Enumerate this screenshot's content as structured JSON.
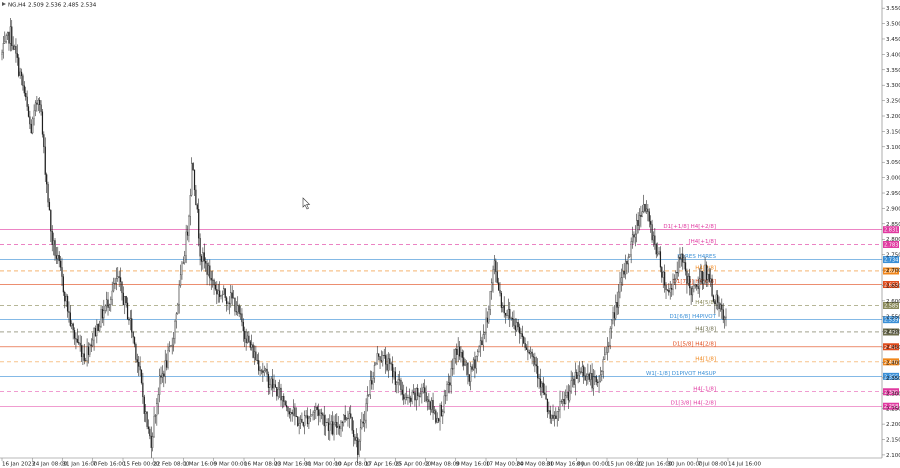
{
  "header": {
    "symbol_label": "NG,H4",
    "ohlc_text": "2.509 2.536 2.485 2.534"
  },
  "colors": {
    "background": "#ffffff",
    "candle": "#1a1a1a",
    "grid": "#e6e6e6",
    "axis": "#777777"
  },
  "chart_data": {
    "type": "candlestick",
    "ylim": [
      2.09,
      3.57
    ],
    "y_ticks": [
      "3.550",
      "3.500",
      "3.450",
      "3.400",
      "3.350",
      "3.300",
      "3.250",
      "3.200",
      "3.150",
      "3.100",
      "3.050",
      "3.000",
      "2.950",
      "2.900",
      "2.850",
      "2.800",
      "2.750",
      "2.700",
      "2.650",
      "2.600",
      "2.550",
      "2.500",
      "2.450",
      "2.400",
      "2.350",
      "2.300",
      "2.250",
      "2.200",
      "2.150",
      "2.100"
    ],
    "x_ticks": [
      "16 Jan 2023",
      "24 Jan 08:00",
      "31 Jan 16:00",
      "7 Feb 16:00",
      "15 Feb 00:00",
      "22 Feb 08:00",
      "1 Mar 16:00",
      "9 Mar 00:00",
      "16 Mar 08:00",
      "23 Mar 16:00",
      "31 Mar 00:00",
      "10 Apr 08:00",
      "17 Apr 16:00",
      "25 Apr 00:00",
      "2 May 08:00",
      "9 May 16:00",
      "17 May 00:00",
      "24 May 08:00",
      "31 May 16:00",
      "8 Jun 00:00",
      "15 Jun 08:00",
      "22 Jun 16:00",
      "30 Jun 00:00",
      "7 Jul 08:00",
      "14 Jul 16:00"
    ],
    "price_path": [
      [
        0,
        3.4
      ],
      [
        0.01,
        3.47
      ],
      [
        0.025,
        3.3
      ],
      [
        0.035,
        3.15
      ],
      [
        0.045,
        3.28
      ],
      [
        0.05,
        3.1
      ],
      [
        0.06,
        2.8
      ],
      [
        0.07,
        2.7
      ],
      [
        0.085,
        2.5
      ],
      [
        0.1,
        2.42
      ],
      [
        0.12,
        2.55
      ],
      [
        0.14,
        2.67
      ],
      [
        0.155,
        2.53
      ],
      [
        0.165,
        2.39
      ],
      [
        0.175,
        2.2
      ],
      [
        0.18,
        2.14
      ],
      [
        0.19,
        2.33
      ],
      [
        0.205,
        2.45
      ],
      [
        0.215,
        2.65
      ],
      [
        0.225,
        2.85
      ],
      [
        0.23,
        3.07
      ],
      [
        0.24,
        2.75
      ],
      [
        0.26,
        2.63
      ],
      [
        0.28,
        2.6
      ],
      [
        0.3,
        2.45
      ],
      [
        0.32,
        2.35
      ],
      [
        0.34,
        2.28
      ],
      [
        0.36,
        2.2
      ],
      [
        0.38,
        2.25
      ],
      [
        0.4,
        2.18
      ],
      [
        0.42,
        2.24
      ],
      [
        0.43,
        2.12
      ],
      [
        0.445,
        2.33
      ],
      [
        0.455,
        2.43
      ],
      [
        0.47,
        2.38
      ],
      [
        0.49,
        2.27
      ],
      [
        0.51,
        2.31
      ],
      [
        0.525,
        2.22
      ],
      [
        0.535,
        2.27
      ],
      [
        0.55,
        2.45
      ],
      [
        0.565,
        2.35
      ],
      [
        0.585,
        2.52
      ],
      [
        0.595,
        2.72
      ],
      [
        0.605,
        2.58
      ],
      [
        0.62,
        2.53
      ],
      [
        0.63,
        2.48
      ],
      [
        0.645,
        2.4
      ],
      [
        0.66,
        2.24
      ],
      [
        0.665,
        2.2
      ],
      [
        0.68,
        2.28
      ],
      [
        0.7,
        2.38
      ],
      [
        0.72,
        2.32
      ],
      [
        0.735,
        2.5
      ],
      [
        0.745,
        2.62
      ],
      [
        0.76,
        2.78
      ],
      [
        0.775,
        2.92
      ],
      [
        0.79,
        2.78
      ],
      [
        0.805,
        2.62
      ],
      [
        0.82,
        2.74
      ],
      [
        0.835,
        2.62
      ],
      [
        0.85,
        2.7
      ],
      [
        0.865,
        2.58
      ],
      [
        0.875,
        2.53
      ]
    ],
    "levels": [
      {
        "label": "D1[+1/8] H4[+2/8]",
        "value": 2.831,
        "badge": "2.831",
        "color": "#e03aa0",
        "dash": "none"
      },
      {
        "label": "[H4[+1/8]",
        "value": 2.783,
        "badge": "2.783",
        "color": "#e03aa0",
        "dash": "4,3"
      },
      {
        "label": "D1RES H4RES",
        "value": 2.734,
        "badge": "2.734",
        "color": "#3a8fd6",
        "dash": "none"
      },
      {
        "label": "H4[7/8]",
        "value": 2.697,
        "badge": "2.697",
        "color": "#f0861a",
        "dash": "4,3"
      },
      {
        "label": "D1[7/8] H4[6/8]",
        "value": 2.653,
        "badge": "2.653",
        "color": "#e04a1a",
        "dash": "none"
      },
      {
        "label": "H4[5/8]",
        "value": 2.585,
        "badge": "2.585",
        "color": "#8a8a5a",
        "dash": "4,3"
      },
      {
        "label": "D1[6/8] H4PIVOT",
        "value": 2.539,
        "badge": "2.539",
        "color": "#3a8fd6",
        "dash": "none"
      },
      {
        "label": "H4[3/8]",
        "value": 2.499,
        "badge": "2.499",
        "color": "#6a6a4a",
        "dash": "4,3"
      },
      {
        "label": "D1[5/8] H4[2/8]",
        "value": 2.451,
        "badge": "2.451",
        "color": "#e04a1a",
        "dash": "none"
      },
      {
        "label": "H4[1/8]",
        "value": 2.402,
        "badge": "2.402",
        "color": "#f0861a",
        "dash": "4,3"
      },
      {
        "label": "W1[-1/8] D1PIVOT H4SUP",
        "value": 2.355,
        "badge": "2.355",
        "color": "#3a8fd6",
        "dash": "none"
      },
      {
        "label": "H4[-1/8]",
        "value": 2.305,
        "badge": "2.305",
        "color": "#e03aa0",
        "dash": "4,3"
      },
      {
        "label": "D1[3/8] H4[-2/8]",
        "value": 2.258,
        "badge": "2.258",
        "color": "#e03aa0",
        "dash": "none"
      }
    ]
  }
}
